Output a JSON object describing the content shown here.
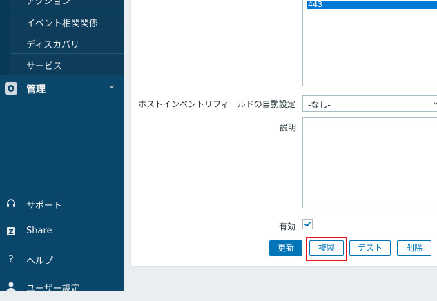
{
  "sidebar": {
    "sub_items": [
      {
        "label": "アクション"
      },
      {
        "label": "イベント相関関係"
      },
      {
        "label": "ディスカバリ"
      },
      {
        "label": "サービス"
      }
    ],
    "admin": {
      "label": "管理",
      "icon": "gear-icon"
    },
    "bottom": [
      {
        "label": "サポート",
        "icon": "headset-icon"
      },
      {
        "label": "Share",
        "icon": "share-z-icon"
      },
      {
        "label": "ヘルプ",
        "icon": "question-icon"
      },
      {
        "label": "ユーザー設定",
        "icon": "user-icon"
      }
    ]
  },
  "form": {
    "listbox_selected": "443",
    "inventory_label": "ホストインベントリフィールドの自動設定",
    "inventory_value": "-なし-",
    "description_label": "説明",
    "enabled_label": "有効",
    "enabled_checked": true
  },
  "buttons": {
    "update": "更新",
    "clone": "複製",
    "test": "テスト",
    "delete": "削除"
  },
  "colors": {
    "sidebar_bg": "#0a466a",
    "primary": "#0275b8",
    "highlight": "#e3161b"
  }
}
